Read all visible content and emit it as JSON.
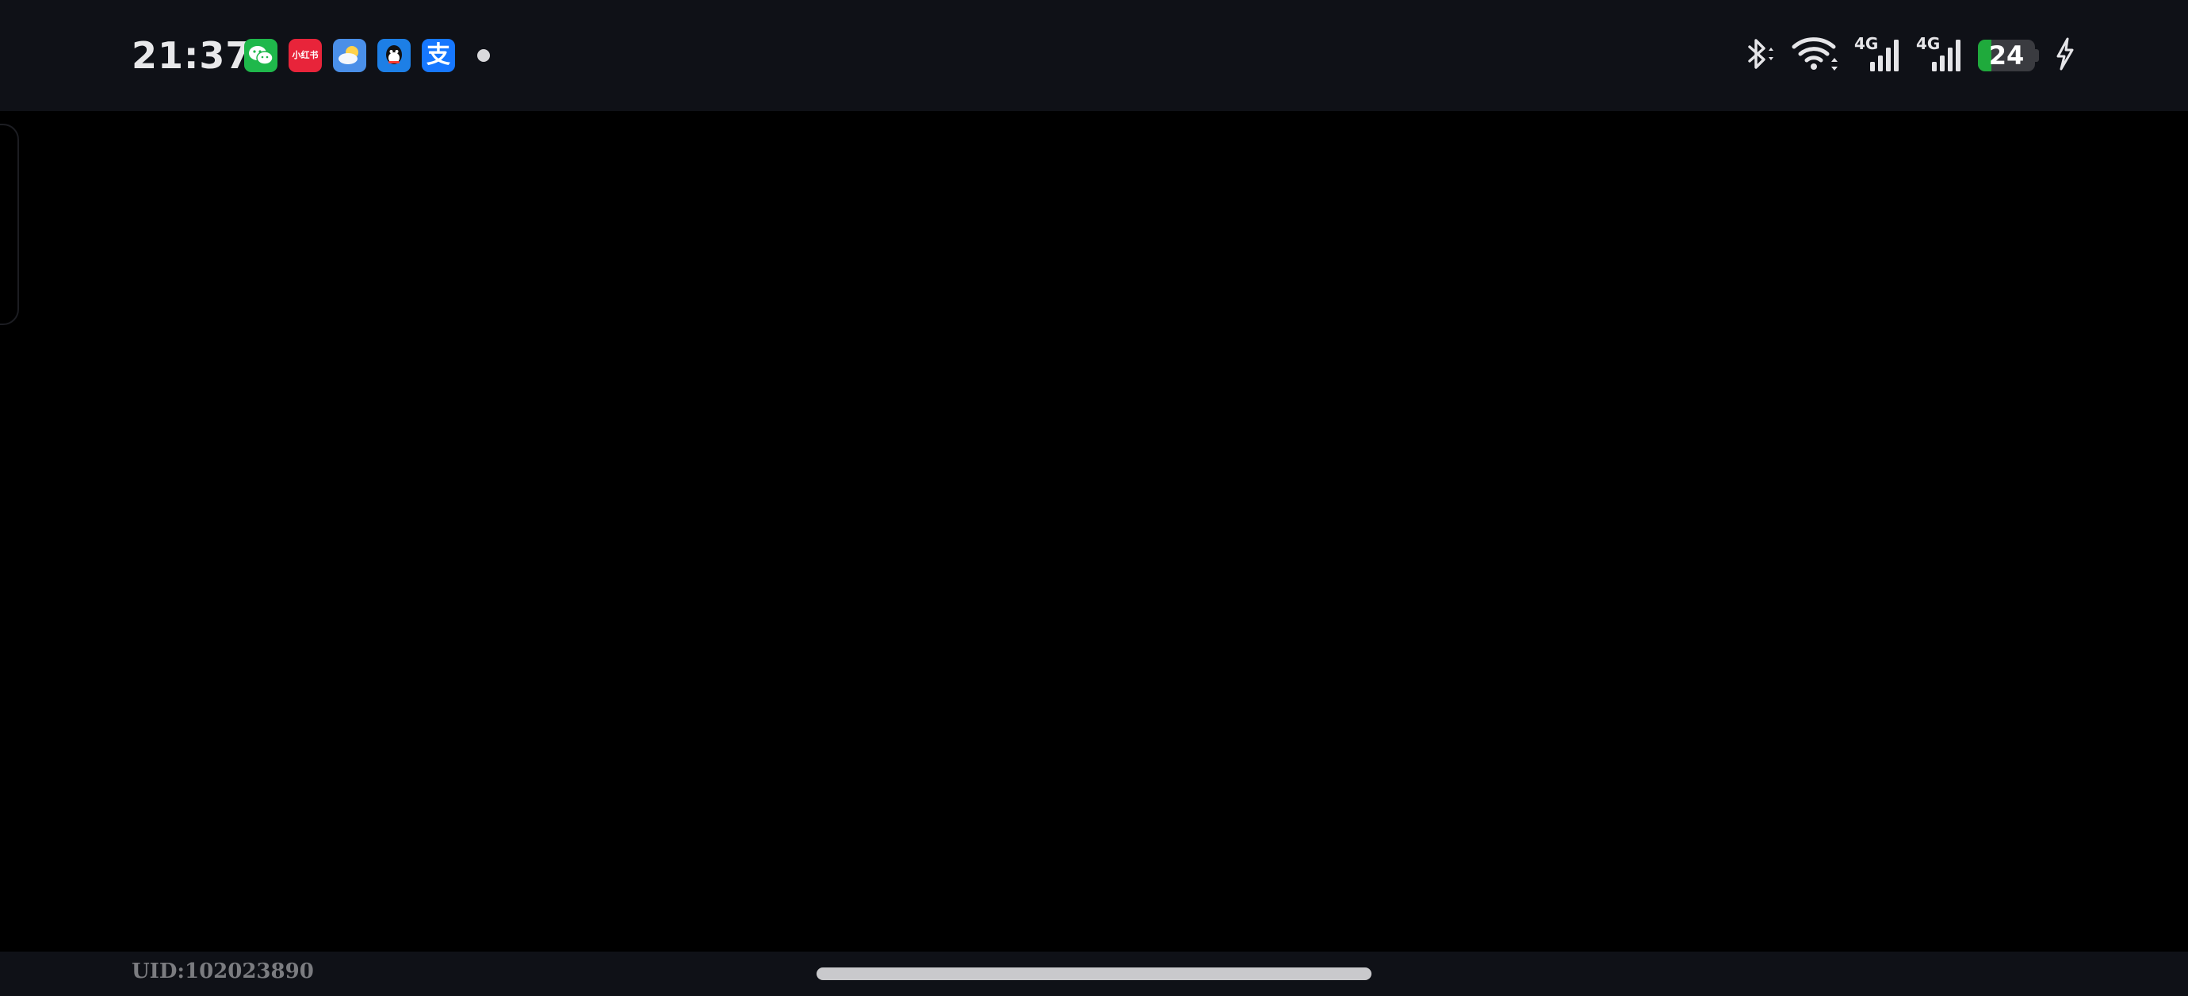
{
  "status_bar": {
    "time": "21:37",
    "notifications": [
      {
        "icon": "wechat-icon",
        "color": "#1fb84b"
      },
      {
        "icon": "xiaohongshu-icon",
        "color": "#e8243a",
        "text": "小红书"
      },
      {
        "icon": "weather-icon",
        "color": "#4a8fe8"
      },
      {
        "icon": "qq-icon",
        "color": "#1d7fe6"
      },
      {
        "icon": "alipay-icon",
        "color": "#1677ff",
        "text": "支"
      }
    ],
    "signal_1_label": "4G",
    "signal_2_label": "4G",
    "battery_level": "24",
    "battery_fraction": 0.24,
    "charging": true,
    "battery_color": "#1faa3c"
  },
  "footer": {
    "uid": "UID:102023890"
  }
}
